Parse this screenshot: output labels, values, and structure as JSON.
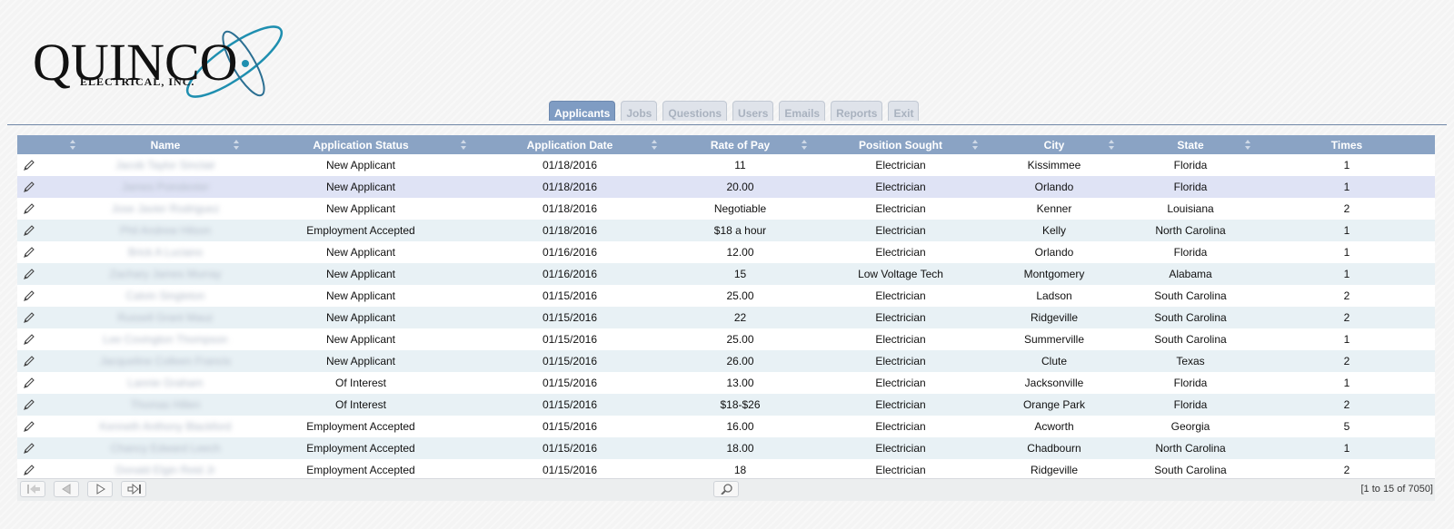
{
  "brand": {
    "name": "QUINCO",
    "subtitle": "ELECTRICAL, INC."
  },
  "tabs": [
    {
      "label": "Applicants",
      "active": true
    },
    {
      "label": "Jobs",
      "active": false
    },
    {
      "label": "Questions",
      "active": false
    },
    {
      "label": "Users",
      "active": false
    },
    {
      "label": "Emails",
      "active": false
    },
    {
      "label": "Reports",
      "active": false
    },
    {
      "label": "Exit",
      "active": false
    }
  ],
  "table": {
    "columns": [
      "",
      "Name",
      "Application Status",
      "Application Date",
      "Rate of Pay",
      "Position Sought",
      "City",
      "State",
      "Times"
    ],
    "rows": [
      [
        "Jacob Taylor Sinclair",
        "New Applicant",
        "01/18/2016",
        "11",
        "Electrician",
        "Kissimmee",
        "Florida",
        "1"
      ],
      [
        "James Poindexter",
        "New Applicant",
        "01/18/2016",
        "20.00",
        "Electrician",
        "Orlando",
        "Florida",
        "1"
      ],
      [
        "Jose Javier Rodriguez",
        "New Applicant",
        "01/18/2016",
        "Negotiable",
        "Electrician",
        "Kenner",
        "Louisiana",
        "2"
      ],
      [
        "Phil Andrew Hilson",
        "Employment Accepted",
        "01/18/2016",
        "$18 a hour",
        "Electrician",
        "Kelly",
        "North Carolina",
        "1"
      ],
      [
        "Brick A Luciano",
        "New Applicant",
        "01/16/2016",
        "12.00",
        "Electrician",
        "Orlando",
        "Florida",
        "1"
      ],
      [
        "Zachary James Murray",
        "New Applicant",
        "01/16/2016",
        "15",
        "Low Voltage Tech",
        "Montgomery",
        "Alabama",
        "1"
      ],
      [
        "Calvin Singleton",
        "New Applicant",
        "01/15/2016",
        "25.00",
        "Electrician",
        "Ladson",
        "South Carolina",
        "2"
      ],
      [
        "Russell Grant Mauz",
        "New Applicant",
        "01/15/2016",
        "22",
        "Electrician",
        "Ridgeville",
        "South Carolina",
        "2"
      ],
      [
        "Lee Covington Thompson",
        "New Applicant",
        "01/15/2016",
        "25.00",
        "Electrician",
        "Summerville",
        "South Carolina",
        "1"
      ],
      [
        "Jacqueline Colleen Francis",
        "New Applicant",
        "01/15/2016",
        "26.00",
        "Electrician",
        "Clute",
        "Texas",
        "2"
      ],
      [
        "Lannie Graham",
        "Of Interest",
        "01/15/2016",
        "13.00",
        "Electrician",
        "Jacksonville",
        "Florida",
        "1"
      ],
      [
        "Thomas Hillen",
        "Of Interest",
        "01/15/2016",
        "$18-$26",
        "Electrician",
        "Orange Park",
        "Florida",
        "2"
      ],
      [
        "Kenneth Anthony Blackford",
        "Employment Accepted",
        "01/15/2016",
        "16.00",
        "Electrician",
        "Acworth",
        "Georgia",
        "5"
      ],
      [
        "Chancy Edward Leech",
        "Employment Accepted",
        "01/15/2016",
        "18.00",
        "Electrician",
        "Chadbourn",
        "North Carolina",
        "1"
      ],
      [
        "Donald Elgin Reid Jr",
        "Employment Accepted",
        "01/15/2016",
        "18",
        "Electrician",
        "Ridgeville",
        "South Carolina",
        "2"
      ]
    ]
  },
  "pager": {
    "info": "[1 to 15 of 7050]"
  },
  "colors": {
    "header": "#8aa3c4",
    "tab_active": "#7f9cc3",
    "logo_swoosh": "#1f8fb0"
  }
}
